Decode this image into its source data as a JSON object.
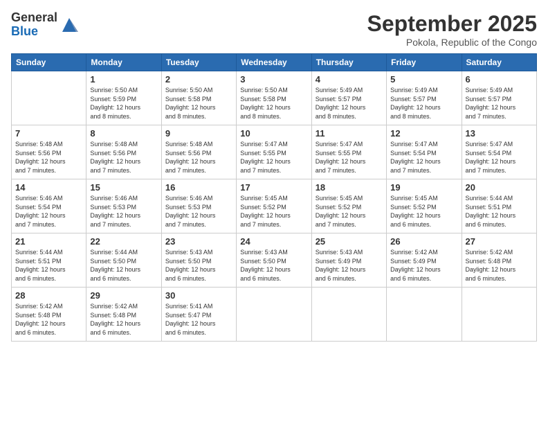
{
  "logo": {
    "general": "General",
    "blue": "Blue"
  },
  "title": "September 2025",
  "location": "Pokola, Republic of the Congo",
  "days_of_week": [
    "Sunday",
    "Monday",
    "Tuesday",
    "Wednesday",
    "Thursday",
    "Friday",
    "Saturday"
  ],
  "weeks": [
    [
      {
        "day": "",
        "info": ""
      },
      {
        "day": "1",
        "info": "Sunrise: 5:50 AM\nSunset: 5:59 PM\nDaylight: 12 hours\nand 8 minutes."
      },
      {
        "day": "2",
        "info": "Sunrise: 5:50 AM\nSunset: 5:58 PM\nDaylight: 12 hours\nand 8 minutes."
      },
      {
        "day": "3",
        "info": "Sunrise: 5:50 AM\nSunset: 5:58 PM\nDaylight: 12 hours\nand 8 minutes."
      },
      {
        "day": "4",
        "info": "Sunrise: 5:49 AM\nSunset: 5:57 PM\nDaylight: 12 hours\nand 8 minutes."
      },
      {
        "day": "5",
        "info": "Sunrise: 5:49 AM\nSunset: 5:57 PM\nDaylight: 12 hours\nand 8 minutes."
      },
      {
        "day": "6",
        "info": "Sunrise: 5:49 AM\nSunset: 5:57 PM\nDaylight: 12 hours\nand 7 minutes."
      }
    ],
    [
      {
        "day": "7",
        "info": "Sunrise: 5:48 AM\nSunset: 5:56 PM\nDaylight: 12 hours\nand 7 minutes."
      },
      {
        "day": "8",
        "info": "Sunrise: 5:48 AM\nSunset: 5:56 PM\nDaylight: 12 hours\nand 7 minutes."
      },
      {
        "day": "9",
        "info": "Sunrise: 5:48 AM\nSunset: 5:56 PM\nDaylight: 12 hours\nand 7 minutes."
      },
      {
        "day": "10",
        "info": "Sunrise: 5:47 AM\nSunset: 5:55 PM\nDaylight: 12 hours\nand 7 minutes."
      },
      {
        "day": "11",
        "info": "Sunrise: 5:47 AM\nSunset: 5:55 PM\nDaylight: 12 hours\nand 7 minutes."
      },
      {
        "day": "12",
        "info": "Sunrise: 5:47 AM\nSunset: 5:54 PM\nDaylight: 12 hours\nand 7 minutes."
      },
      {
        "day": "13",
        "info": "Sunrise: 5:47 AM\nSunset: 5:54 PM\nDaylight: 12 hours\nand 7 minutes."
      }
    ],
    [
      {
        "day": "14",
        "info": "Sunrise: 5:46 AM\nSunset: 5:54 PM\nDaylight: 12 hours\nand 7 minutes."
      },
      {
        "day": "15",
        "info": "Sunrise: 5:46 AM\nSunset: 5:53 PM\nDaylight: 12 hours\nand 7 minutes."
      },
      {
        "day": "16",
        "info": "Sunrise: 5:46 AM\nSunset: 5:53 PM\nDaylight: 12 hours\nand 7 minutes."
      },
      {
        "day": "17",
        "info": "Sunrise: 5:45 AM\nSunset: 5:52 PM\nDaylight: 12 hours\nand 7 minutes."
      },
      {
        "day": "18",
        "info": "Sunrise: 5:45 AM\nSunset: 5:52 PM\nDaylight: 12 hours\nand 7 minutes."
      },
      {
        "day": "19",
        "info": "Sunrise: 5:45 AM\nSunset: 5:52 PM\nDaylight: 12 hours\nand 6 minutes."
      },
      {
        "day": "20",
        "info": "Sunrise: 5:44 AM\nSunset: 5:51 PM\nDaylight: 12 hours\nand 6 minutes."
      }
    ],
    [
      {
        "day": "21",
        "info": "Sunrise: 5:44 AM\nSunset: 5:51 PM\nDaylight: 12 hours\nand 6 minutes."
      },
      {
        "day": "22",
        "info": "Sunrise: 5:44 AM\nSunset: 5:50 PM\nDaylight: 12 hours\nand 6 minutes."
      },
      {
        "day": "23",
        "info": "Sunrise: 5:43 AM\nSunset: 5:50 PM\nDaylight: 12 hours\nand 6 minutes."
      },
      {
        "day": "24",
        "info": "Sunrise: 5:43 AM\nSunset: 5:50 PM\nDaylight: 12 hours\nand 6 minutes."
      },
      {
        "day": "25",
        "info": "Sunrise: 5:43 AM\nSunset: 5:49 PM\nDaylight: 12 hours\nand 6 minutes."
      },
      {
        "day": "26",
        "info": "Sunrise: 5:42 AM\nSunset: 5:49 PM\nDaylight: 12 hours\nand 6 minutes."
      },
      {
        "day": "27",
        "info": "Sunrise: 5:42 AM\nSunset: 5:48 PM\nDaylight: 12 hours\nand 6 minutes."
      }
    ],
    [
      {
        "day": "28",
        "info": "Sunrise: 5:42 AM\nSunset: 5:48 PM\nDaylight: 12 hours\nand 6 minutes."
      },
      {
        "day": "29",
        "info": "Sunrise: 5:42 AM\nSunset: 5:48 PM\nDaylight: 12 hours\nand 6 minutes."
      },
      {
        "day": "30",
        "info": "Sunrise: 5:41 AM\nSunset: 5:47 PM\nDaylight: 12 hours\nand 6 minutes."
      },
      {
        "day": "",
        "info": ""
      },
      {
        "day": "",
        "info": ""
      },
      {
        "day": "",
        "info": ""
      },
      {
        "day": "",
        "info": ""
      }
    ]
  ]
}
